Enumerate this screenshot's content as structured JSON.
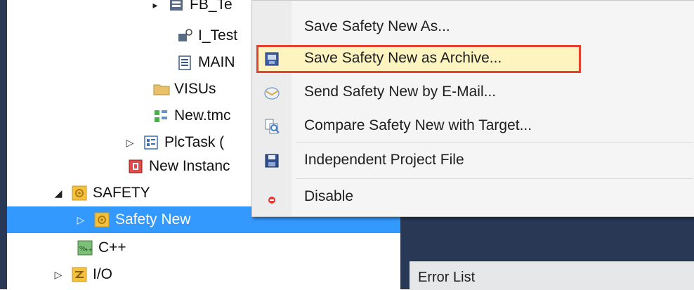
{
  "tree": {
    "items": [
      {
        "label": "FB_Te",
        "icon": "function-block-icon",
        "expand": "▸"
      },
      {
        "label": "I_Test",
        "icon": "interface-icon",
        "expand": ""
      },
      {
        "label": "MAIN",
        "icon": "program-icon",
        "expand": ""
      },
      {
        "label": "VISUs",
        "icon": "folder-icon",
        "expand": ""
      },
      {
        "label": "New.tmc",
        "icon": "tmc-icon",
        "expand": ""
      },
      {
        "label": "PlcTask (",
        "icon": "task-icon",
        "expand": "▷"
      },
      {
        "label": "New Instanc",
        "icon": "instance-icon",
        "expand": ""
      },
      {
        "label": "SAFETY",
        "icon": "safety-icon",
        "expand": "◢"
      },
      {
        "label": "Safety New",
        "icon": "safety-project-icon",
        "expand": "▷"
      },
      {
        "label": "C++",
        "icon": "cpp-icon",
        "expand": ""
      },
      {
        "label": "I/O",
        "icon": "io-icon",
        "expand": "▷"
      }
    ]
  },
  "context_menu": {
    "items": [
      {
        "label": "Save Safety New As...",
        "icon": ""
      },
      {
        "label": "Save Safety New as Archive...",
        "icon": "archive-icon"
      },
      {
        "label": "Send Safety New by E-Mail...",
        "icon": "email-icon"
      },
      {
        "label": "Compare Safety New with Target...",
        "icon": "compare-icon"
      },
      {
        "label": "Independent Project File",
        "icon": "save-disk-icon"
      },
      {
        "label": "Disable",
        "icon": "disable-dot-icon"
      }
    ],
    "highlight_color": "#e8412e"
  },
  "error_panel": {
    "title": "Error List"
  },
  "colors": {
    "selection": "#3399ff",
    "dark": "#293955"
  }
}
